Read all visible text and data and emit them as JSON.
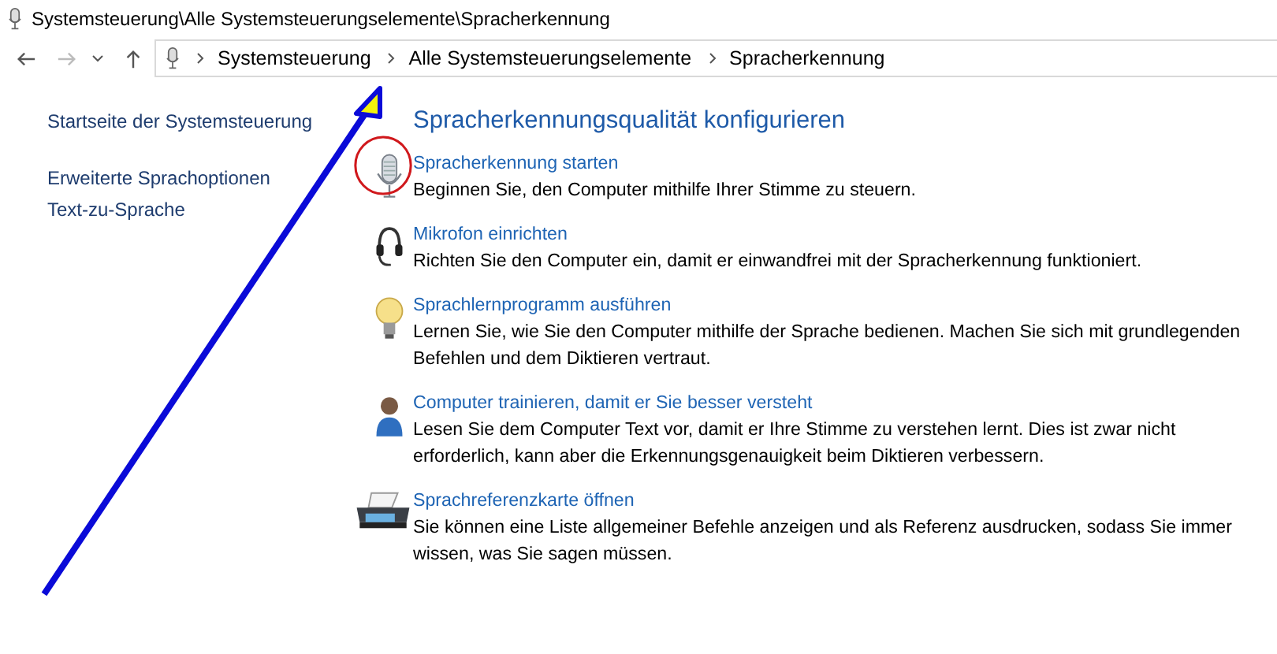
{
  "window": {
    "title": "Systemsteuerung\\Alle Systemsteuerungselemente\\Spracherkennung"
  },
  "address_bar": {
    "breadcrumbs": [
      "Systemsteuerung",
      "Alle Systemsteuerungselemente",
      "Spracherkennung"
    ]
  },
  "sidebar": {
    "items": [
      {
        "label": "Startseite der Systemsteuerung",
        "kind": "home"
      },
      {
        "label": "Erweiterte Sprachoptionen",
        "kind": "link"
      },
      {
        "label": "Text-zu-Sprache",
        "kind": "link"
      }
    ]
  },
  "heading": "Spracherkennungsqualität konfigurieren",
  "tasks": [
    {
      "kind": "microphone",
      "title": "Spracherkennung starten",
      "description": "Beginnen Sie, den Computer mithilfe Ihrer Stimme zu steuern.",
      "highlighted": true
    },
    {
      "kind": "headset",
      "title": "Mikrofon einrichten",
      "description": "Richten Sie den Computer ein, damit er einwandfrei mit der Spracherkennung funktioniert.",
      "highlighted": false
    },
    {
      "kind": "bulb",
      "title": "Sprachlernprogramm ausführen",
      "description": "Lernen Sie, wie Sie den Computer mithilfe der Sprache bedienen. Machen Sie sich mit grundlegenden Befehlen und dem Diktieren vertraut.",
      "highlighted": false
    },
    {
      "kind": "user",
      "title": "Computer trainieren, damit er Sie besser versteht",
      "description": "Lesen Sie dem Computer Text vor, damit er Ihre Stimme zu verstehen lernt. Dies ist zwar nicht erforderlich, kann aber die Erkennungsgenauigkeit beim Diktieren verbessern.",
      "highlighted": false
    },
    {
      "kind": "printer",
      "title": "Sprachreferenzkarte öffnen",
      "description": "Sie können eine Liste allgemeiner Befehle anzeigen und als Referenz ausdrucken, sodass Sie immer wissen, was Sie sagen müssen.",
      "highlighted": false
    }
  ]
}
